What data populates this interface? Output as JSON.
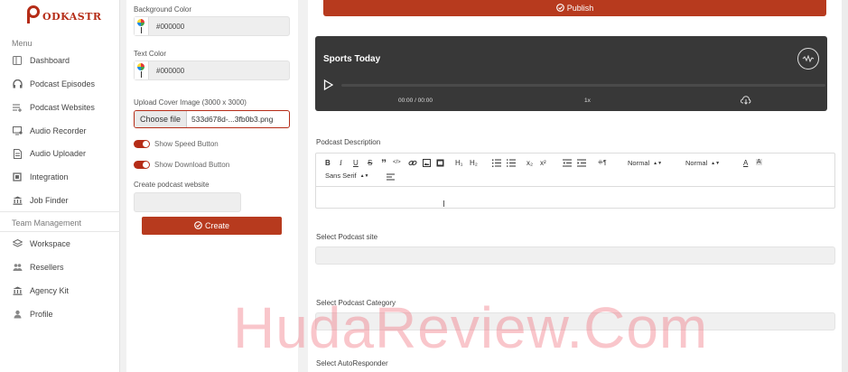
{
  "brand": {
    "name": "ODKASTR",
    "color": "#b52c17"
  },
  "sidebar": {
    "menu_heading": "Menu",
    "items": [
      {
        "label": "Dashboard",
        "icon": "columns-icon"
      },
      {
        "label": "Podcast Episodes",
        "icon": "headphones-icon"
      },
      {
        "label": "Podcast Websites",
        "icon": "list-icon"
      },
      {
        "label": "Audio Recorder",
        "icon": "monitor-mic-icon"
      },
      {
        "label": "Audio Uploader",
        "icon": "file-icon"
      },
      {
        "label": "Integration",
        "icon": "cube-icon"
      },
      {
        "label": "Job Finder",
        "icon": "bank-icon"
      }
    ],
    "team_heading": "Team Management",
    "team_items": [
      {
        "label": "Workspace",
        "icon": "stack-icon"
      },
      {
        "label": "Resellers",
        "icon": "users-icon"
      },
      {
        "label": "Agency Kit",
        "icon": "bank-icon"
      },
      {
        "label": "Profile",
        "icon": "person-icon"
      }
    ]
  },
  "settings": {
    "background_color_label": "Background Color",
    "background_color_value": "#000000",
    "text_color_label": "Text Color",
    "text_color_value": "#000000",
    "cover_label": "Upload Cover Image (3000 x 3000)",
    "choose_file_label": "Choose file",
    "file_name": "533d678d-...3fb0b3.png",
    "speed_toggle_label": "Show Speed Button",
    "download_toggle_label": "Show Download Button",
    "website_label": "Create podcast website",
    "create_label": "Create"
  },
  "main": {
    "publish_label": "Publish",
    "player": {
      "title": "Sports Today",
      "time": "00:00 / 00:00",
      "speed": "1x",
      "background": "#383838"
    },
    "description_label": "Podcast Description",
    "toolbar": {
      "bold": "B",
      "italic": "I",
      "underline": "U",
      "strike": "S",
      "quote": "”",
      "code": "</>",
      "h1": "H₁",
      "h2": "H₂",
      "sub": "x₂",
      "sup": "x²",
      "size1": "Normal",
      "size2": "Normal",
      "font": "Sans Serif",
      "color_a": "A",
      "bg_a": "A"
    },
    "site_label": "Select Podcast site",
    "category_label": "Select Podcast Category",
    "autoresponder_label": "Select AutoResponder"
  },
  "watermark": "HudaReview.Com",
  "accent_color": "#b73a1e"
}
